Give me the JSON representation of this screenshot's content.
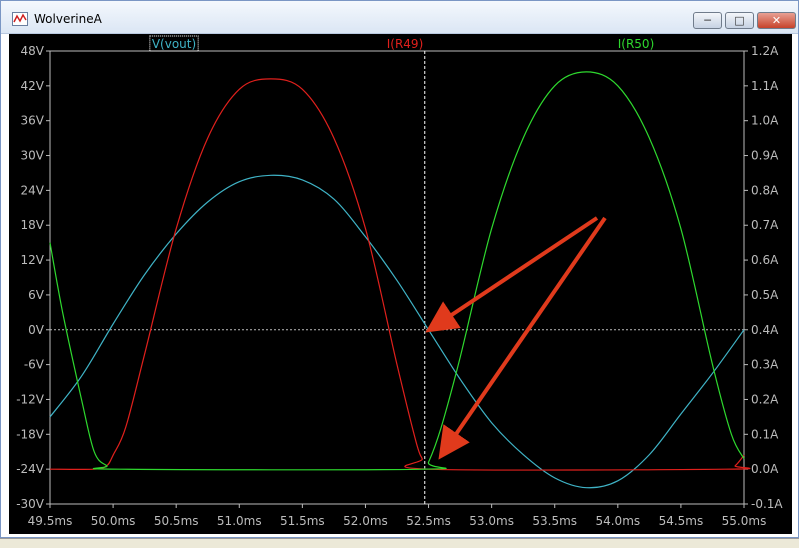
{
  "window": {
    "title": "WolverineA",
    "icon": "waveform-icon",
    "controls": {
      "minimize": "minimize-icon",
      "maximize": "maximize-icon",
      "close": "close-icon"
    }
  },
  "colors": {
    "background": "#000000",
    "axis": "#bcbcbc",
    "grid": "#bcbcbc",
    "vout": "#3fb3c6",
    "r49": "#e0201c",
    "r50": "#2ed82e",
    "cursor": "#ffffff",
    "arrow": "#e03a1c"
  },
  "chart_data": {
    "type": "line",
    "title": "",
    "xlabel": "",
    "ylabel": "",
    "grid": false,
    "cursor_x": 52.47,
    "x_axis": {
      "range": [
        49.5,
        55.0
      ],
      "ticks": [
        49.5,
        50.0,
        50.5,
        51.0,
        51.5,
        52.0,
        52.5,
        53.0,
        53.5,
        54.0,
        54.5,
        55.0
      ],
      "tick_labels": [
        "49.5ms",
        "50.0ms",
        "50.5ms",
        "51.0ms",
        "51.5ms",
        "52.0ms",
        "52.5ms",
        "53.0ms",
        "53.5ms",
        "54.0ms",
        "54.5ms",
        "55.0ms"
      ]
    },
    "y_left": {
      "range": [
        -30,
        48
      ],
      "ticks": [
        -30,
        -24,
        -18,
        -12,
        -6,
        0,
        6,
        12,
        18,
        24,
        30,
        36,
        42,
        48
      ],
      "tick_labels": [
        "-30V",
        "-24V",
        "-18V",
        "-12V",
        "-6V",
        "0V",
        "6V",
        "12V",
        "18V",
        "24V",
        "30V",
        "36V",
        "42V",
        "48V"
      ]
    },
    "y_right": {
      "range": [
        -0.1,
        1.2
      ],
      "ticks": [
        -0.1,
        0.0,
        0.1,
        0.2,
        0.3,
        0.4,
        0.5,
        0.6,
        0.7,
        0.8,
        0.9,
        1.0,
        1.1,
        1.2
      ],
      "tick_labels": [
        "-0.1A",
        "0.0A",
        "0.1A",
        "0.2A",
        "0.3A",
        "0.4A",
        "0.5A",
        "0.6A",
        "0.7A",
        "0.8A",
        "0.9A",
        "1.0A",
        "1.1A",
        "1.2A"
      ]
    },
    "series": [
      {
        "name": "V(vout)",
        "axis": "left",
        "color": "#3fb3c6",
        "x": [
          49.5,
          49.75,
          50.0,
          50.25,
          50.5,
          50.75,
          51.0,
          51.25,
          51.5,
          51.75,
          52.0,
          52.25,
          52.5,
          52.75,
          53.0,
          53.25,
          53.5,
          53.75,
          54.0,
          54.25,
          54.5,
          54.75,
          55.0
        ],
        "y": [
          -15.0,
          -8.0,
          1.0,
          9.5,
          16.5,
          22.0,
          25.5,
          26.6,
          25.8,
          22.5,
          16.0,
          8.5,
          0.0,
          -8.5,
          -16.0,
          -21.5,
          -25.5,
          -27.2,
          -26.0,
          -21.5,
          -14.5,
          -7.5,
          0.0
        ]
      },
      {
        "name": "I(R49)",
        "axis": "right",
        "color": "#e0201c",
        "x": [
          49.5,
          49.85,
          49.95,
          50.0,
          50.1,
          50.25,
          50.5,
          50.75,
          51.0,
          51.25,
          51.5,
          51.75,
          52.0,
          52.25,
          52.4,
          52.45,
          52.5,
          54.85,
          54.93,
          55.0
        ],
        "y": [
          0.0,
          0.0,
          0.01,
          0.04,
          0.12,
          0.33,
          0.69,
          0.95,
          1.09,
          1.12,
          1.09,
          0.95,
          0.69,
          0.3,
          0.08,
          0.03,
          0.0,
          0.0,
          0.01,
          0.04
        ]
      },
      {
        "name": "I(R50)",
        "axis": "right",
        "color": "#2ed82e",
        "x": [
          49.5,
          49.6,
          49.75,
          49.85,
          49.95,
          50.05,
          52.45,
          52.5,
          52.6,
          52.75,
          53.0,
          53.25,
          53.5,
          53.75,
          54.0,
          54.25,
          54.5,
          54.75,
          54.9,
          55.0
        ],
        "y": [
          0.65,
          0.45,
          0.2,
          0.05,
          0.01,
          0.0,
          0.0,
          0.02,
          0.12,
          0.32,
          0.69,
          0.95,
          1.1,
          1.14,
          1.1,
          0.95,
          0.69,
          0.3,
          0.1,
          0.03
        ]
      }
    ]
  }
}
